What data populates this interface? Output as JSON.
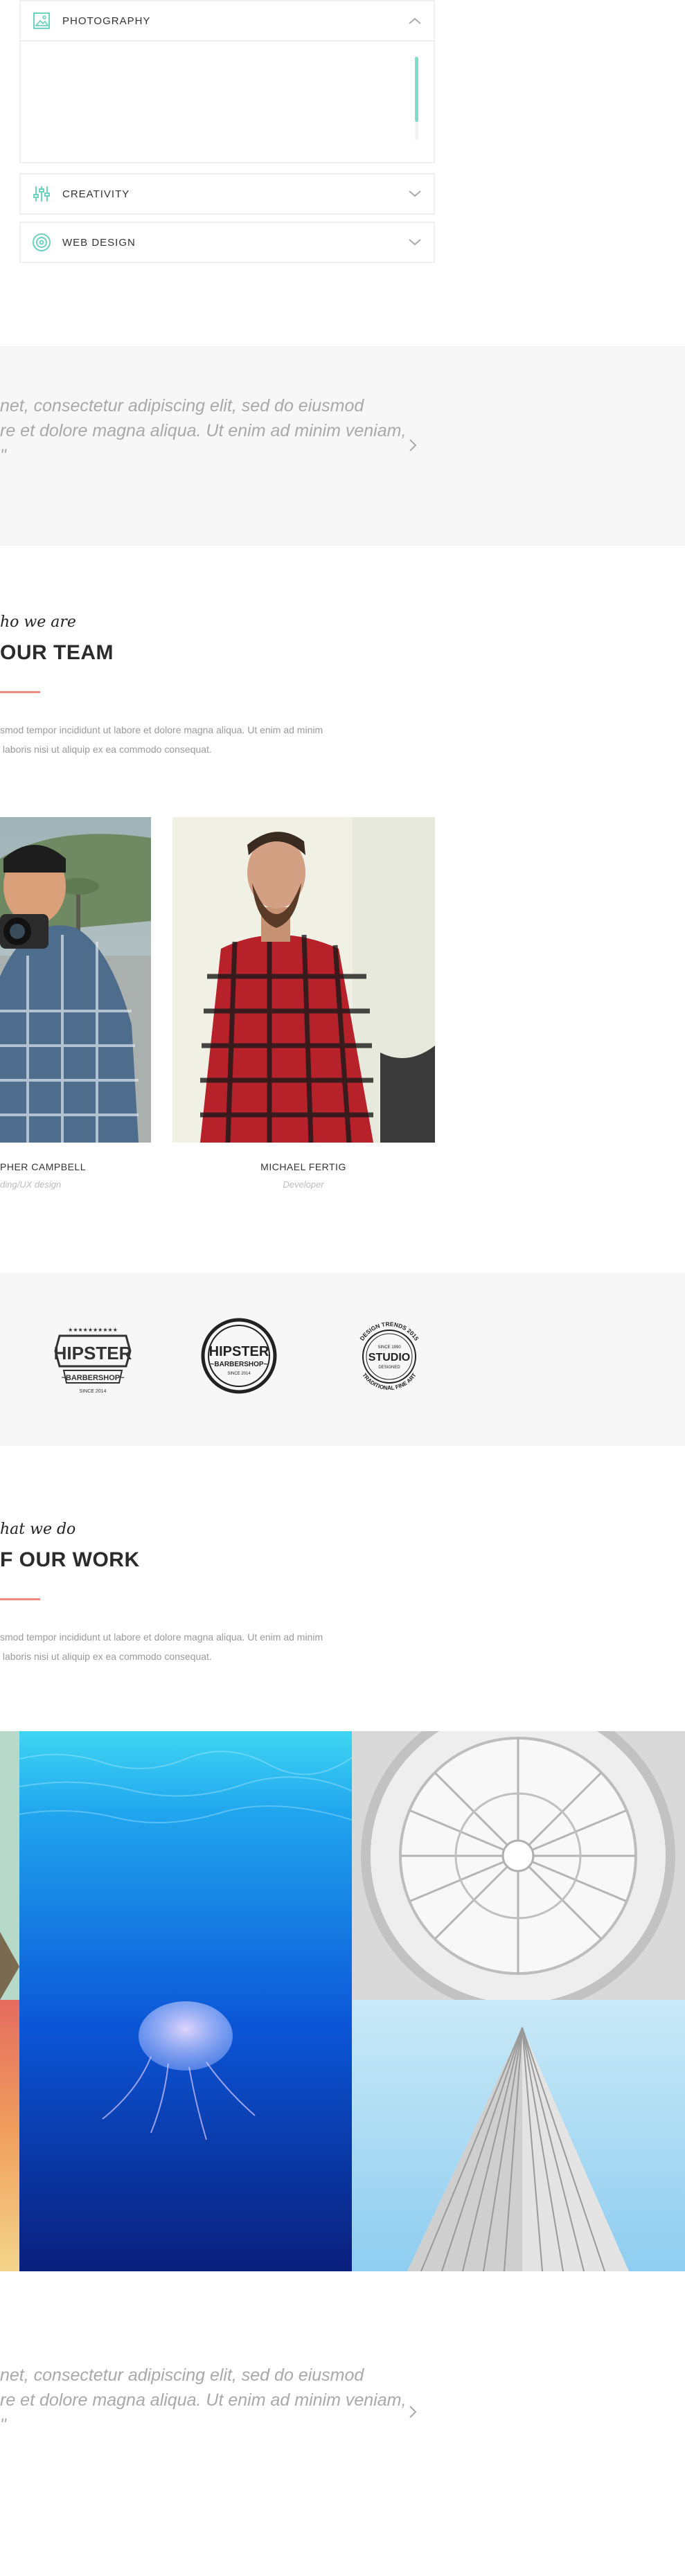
{
  "accordion": {
    "items": [
      {
        "label": "PHOTOGRAPHY",
        "icon": "image-icon",
        "expanded": true
      },
      {
        "label": "CREATIVITY",
        "icon": "sliders-icon",
        "expanded": false
      },
      {
        "label": "WEB DESIGN",
        "icon": "target-icon",
        "expanded": false
      }
    ]
  },
  "quote_top": {
    "line1": "net, consectetur adipiscing elit, sed do eiusmod",
    "line2": "re et dolore magna aliqua. Ut enim ad minim veniam,",
    "line3": "\""
  },
  "team": {
    "kicker": "ho we are",
    "heading": "OUR TEAM",
    "text_line1": "smod tempor incididunt ut labore et dolore magna aliqua. Ut enim ad minim",
    "text_line2": " laboris nisi ut aliquip ex ea commodo consequat.",
    "members": [
      {
        "name": "PHER CAMPBELL",
        "role": "ding/UX design"
      },
      {
        "name": "MICHAEL FERTIG",
        "role": "Developer"
      }
    ]
  },
  "clients": {
    "logos": [
      {
        "top": "★★★★★★★★★★",
        "main": "HIPSTER",
        "sub": "~BARBERSHOP~",
        "since": "SINCE 2014"
      },
      {
        "main": "HIPSTER",
        "sub": "~BARBERSHOP~",
        "since": "SINCE 2014"
      },
      {
        "ring_top": "DESIGN TRENDS 2015",
        "small": "SINCE 1990",
        "main": "STUDIO",
        "mid": "DESIGNED",
        "ring_bottom": "TRADITIONAL FINE ART"
      }
    ]
  },
  "work": {
    "kicker": "hat we do",
    "heading": "F OUR WORK",
    "text_line1": "smod tempor incididunt ut labore et dolore magna aliqua. Ut enim ad minim",
    "text_line2": " laboris nisi ut aliquip ex ea commodo consequat."
  },
  "quote_bottom": {
    "line1": "net, consectetur adipiscing elit, sed do eiusmod",
    "line2": "re et dolore magna aliqua. Ut enim ad minim veniam,",
    "line3": "\""
  },
  "colors": {
    "accent_teal": "#6dd3c0",
    "accent_red": "#f08a7e",
    "band_gray": "#f7f7f7"
  }
}
